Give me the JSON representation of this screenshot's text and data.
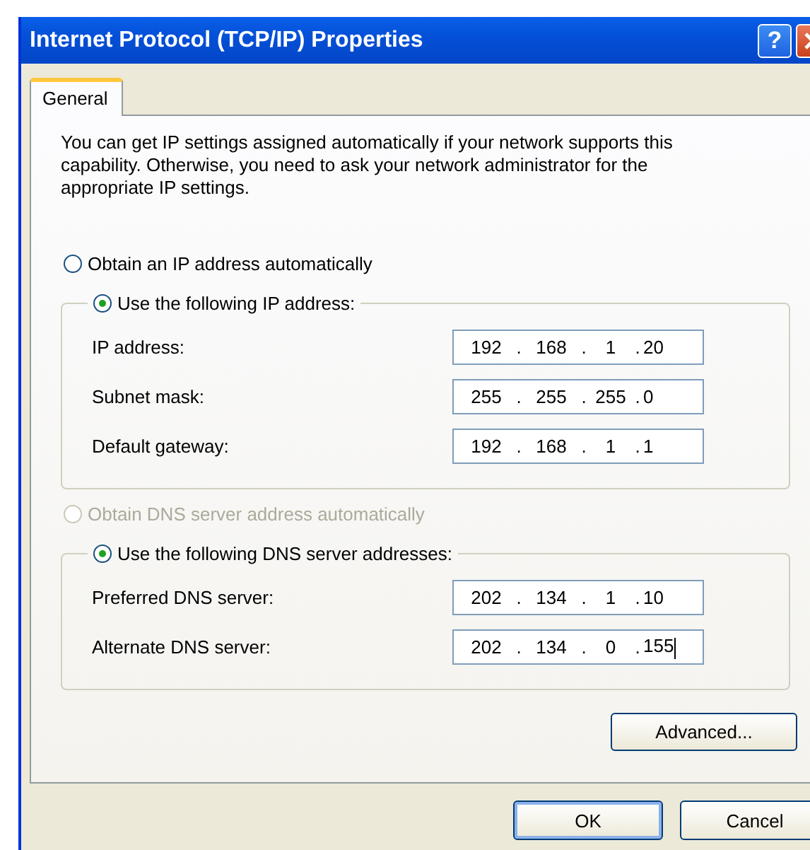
{
  "window": {
    "title": "Internet Protocol (TCP/IP) Properties",
    "help_button": "?"
  },
  "tabs": [
    {
      "label": "General",
      "selected": true
    }
  ],
  "description": "You can get IP settings assigned automatically if your network supports this capability. Otherwise, you need to ask your network administrator for the appropriate IP settings.",
  "sections": [
    {
      "auto_option": {
        "label": "Obtain an IP address automatically",
        "selected": false,
        "disabled": false
      },
      "manual_option": {
        "label": "Use the following IP address:",
        "selected": true,
        "disabled": false
      },
      "fields": [
        {
          "label": "IP address:",
          "octets": [
            "192",
            "168",
            "1",
            "20"
          ],
          "separator": ".",
          "focused": false
        },
        {
          "label": "Subnet mask:",
          "octets": [
            "255",
            "255",
            "255",
            "0"
          ],
          "separator": ".",
          "focused": false
        },
        {
          "label": "Default gateway:",
          "octets": [
            "192",
            "168",
            "1",
            "1"
          ],
          "separator": ".",
          "focused": false
        }
      ]
    },
    {
      "auto_option": {
        "label": "Obtain DNS server address automatically",
        "selected": false,
        "disabled": true
      },
      "manual_option": {
        "label": "Use the following DNS server addresses:",
        "selected": true,
        "disabled": false
      },
      "fields": [
        {
          "label": "Preferred DNS server:",
          "octets": [
            "202",
            "134",
            "1",
            "10"
          ],
          "separator": ".",
          "focused": false
        },
        {
          "label": "Alternate DNS server:",
          "octets": [
            "202",
            "134",
            "0",
            "155"
          ],
          "separator": ".",
          "focused": true
        }
      ]
    }
  ],
  "advanced_button": "Advanced...",
  "buttons": [
    "OK",
    "Cancel"
  ]
}
